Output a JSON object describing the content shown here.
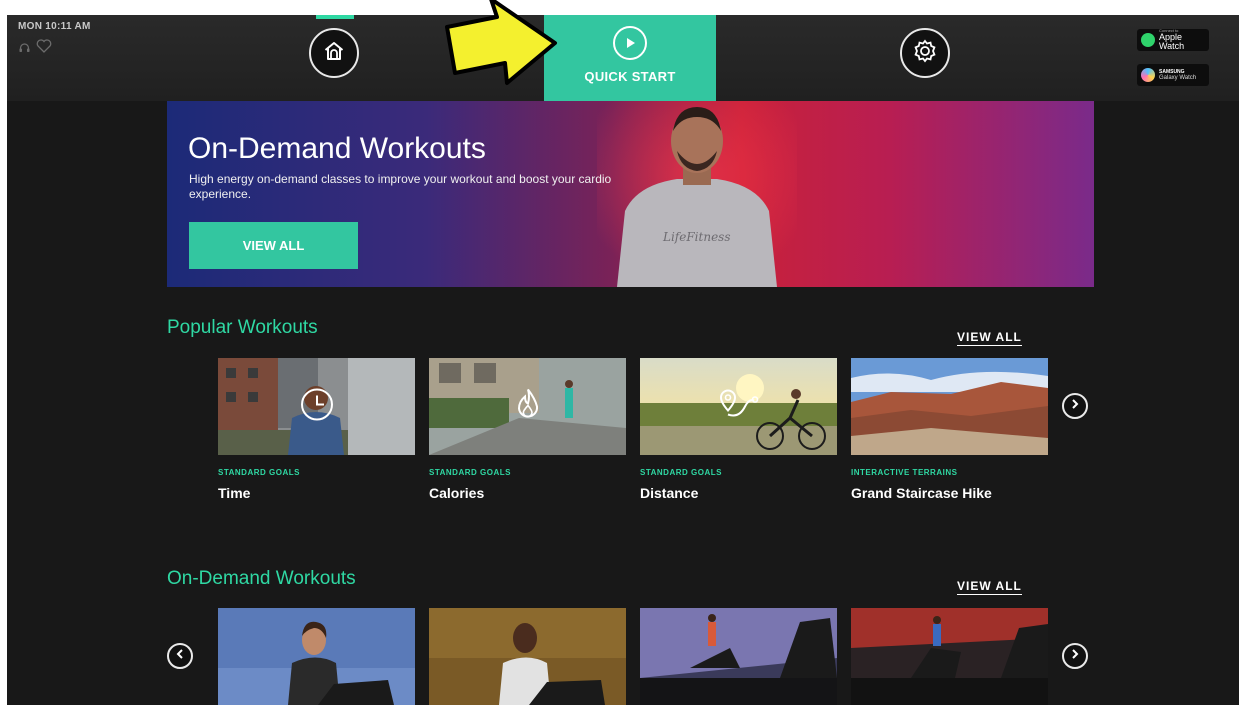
{
  "status": {
    "time": "MON 10:11 AM",
    "icons": [
      "headphones-icon",
      "heart-rate-icon"
    ]
  },
  "nav": {
    "home_icon": "home-icon",
    "quick_start_label": "QUICK START",
    "quick_start_icon": "play-icon",
    "settings_icon": "gear-icon"
  },
  "watches": {
    "apple": {
      "small": "Connect to",
      "label": "Apple Watch",
      "color": "#2fd36b"
    },
    "samsung": {
      "brand": "SAMSUNG",
      "label": "Galaxy Watch"
    }
  },
  "hero": {
    "title": "On-Demand Workouts",
    "description": "High energy on-demand classes to improve your workout and boost your cardio experience.",
    "button": "VIEW ALL",
    "shirt_text": "LifeFitness"
  },
  "popular": {
    "title": "Popular Workouts",
    "view_all": "VIEW ALL",
    "cards": [
      {
        "tag": "STANDARD GOALS",
        "name": "Time",
        "icon": "clock-icon"
      },
      {
        "tag": "STANDARD GOALS",
        "name": "Calories",
        "icon": "flame-icon"
      },
      {
        "tag": "STANDARD GOALS",
        "name": "Distance",
        "icon": "route-icon"
      },
      {
        "tag": "INTERACTIVE TERRAINS",
        "name": "Grand Staircase Hike",
        "icon": ""
      }
    ]
  },
  "ondemand": {
    "title": "On-Demand Workouts",
    "view_all": "VIEW ALL"
  },
  "colors": {
    "accent": "#33c6a0",
    "accent_text": "#2fd8a3",
    "background": "#181818"
  }
}
